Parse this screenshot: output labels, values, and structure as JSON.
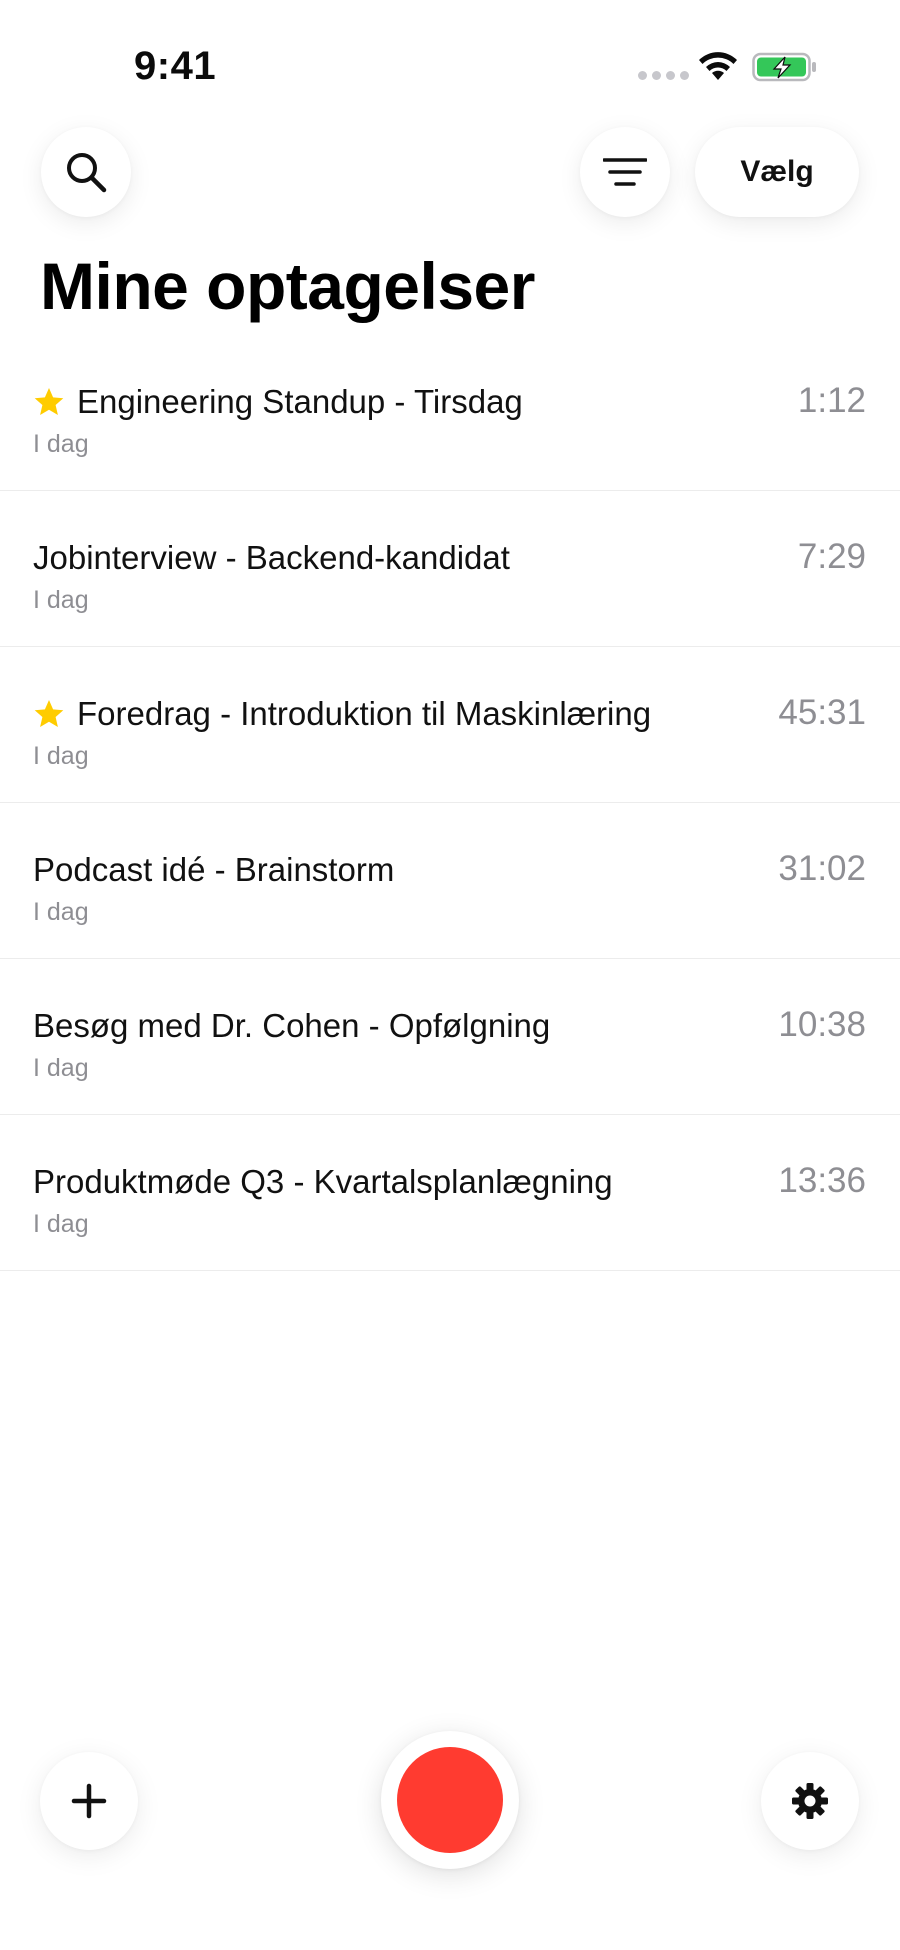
{
  "status_bar": {
    "time": "9:41",
    "icons": [
      "cellular-signal-icon",
      "wifi-icon",
      "battery-charging-icon"
    ]
  },
  "header": {
    "search_icon": "search-icon",
    "filter_icon": "filter-lines-icon",
    "select_label": "Vælg",
    "title": "Mine optagelser"
  },
  "recordings": [
    {
      "title": "Engineering Standup - Tirsdag",
      "date": "I dag",
      "duration": "1:12",
      "starred": true
    },
    {
      "title": "Jobinterview - Backend-kandidat",
      "date": "I dag",
      "duration": "7:29",
      "starred": false
    },
    {
      "title": "Foredrag - Introduktion til Maskinlæring",
      "date": "I dag",
      "duration": "45:31",
      "starred": true
    },
    {
      "title": "Podcast idé - Brainstorm",
      "date": "I dag",
      "duration": "31:02",
      "starred": false
    },
    {
      "title": "Besøg med Dr. Cohen - Opfølgning",
      "date": "I dag",
      "duration": "10:38",
      "starred": false
    },
    {
      "title": "Produktmøde Q3 - Kvartalsplanlægning",
      "date": "I dag",
      "duration": "13:36",
      "starred": false
    }
  ],
  "bottom_bar": {
    "add_icon": "plus-icon",
    "record_icon": "record-icon",
    "settings_icon": "gear-icon"
  },
  "colors": {
    "record": "#ff3b30",
    "star": "#ffcc00",
    "battery": "#34c759",
    "secondary_text": "#8e8e93"
  }
}
